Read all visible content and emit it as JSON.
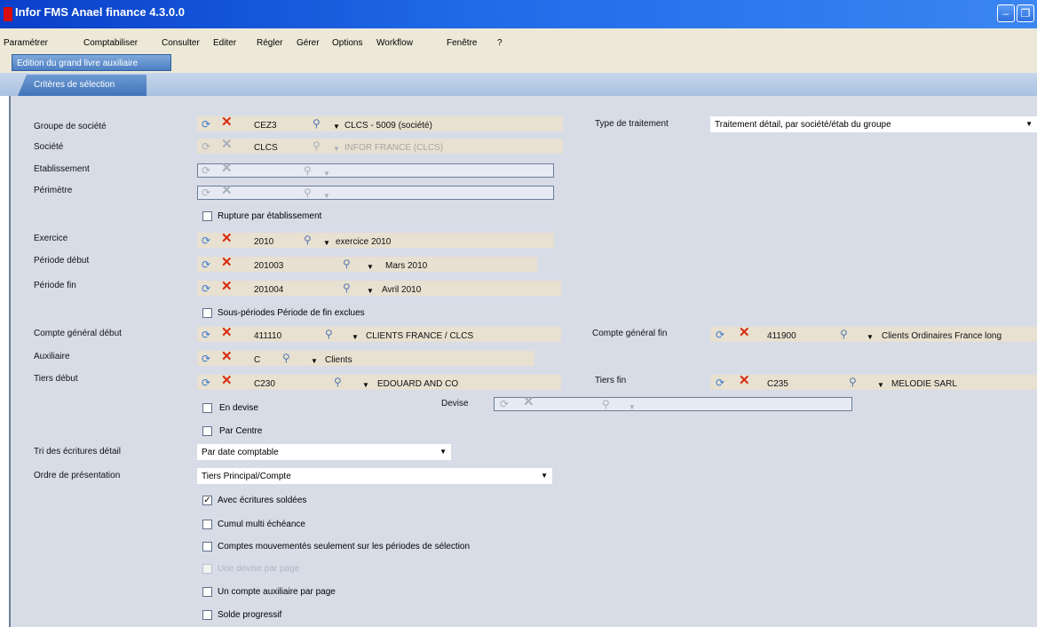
{
  "window": {
    "title": "Infor FMS Anael finance 4.3.0.0"
  },
  "menu": [
    "Paramétrer",
    "Comptabiliser",
    "Consulter",
    "Editer",
    "Régler",
    "Gérer",
    "Options",
    "Workflow",
    "Fenêtre",
    "?"
  ],
  "tabs": {
    "top": "Edition du grand livre auxiliaire",
    "sub": "Critères de sélection"
  },
  "fields": {
    "groupe": {
      "label": "Groupe de société",
      "code": "CEZ3",
      "desc": "CLCS - 5009 (société)"
    },
    "societe": {
      "label": "Société",
      "code": "CLCS",
      "desc": "INFOR FRANCE (CLCS)"
    },
    "etablissement": {
      "label": "Etablissement"
    },
    "perimetre": {
      "label": "Périmètre"
    },
    "rupture": {
      "label": "Rupture par établissement",
      "checked": false
    },
    "exercice": {
      "label": "Exercice",
      "code": "2010",
      "desc": "exercice 2010"
    },
    "periode_debut": {
      "label": "Période début",
      "code": "201003",
      "desc": "Mars 2010"
    },
    "periode_fin": {
      "label": "Période fin",
      "code": "201004",
      "desc": "Avril 2010"
    },
    "sous_periodes": {
      "label": "Sous-périodes Période de fin exclues",
      "checked": false
    },
    "compte_debut": {
      "label": "Compte général début",
      "code": "411110",
      "desc": "CLIENTS FRANCE / CLCS"
    },
    "auxiliaire": {
      "label": "Auxiliaire",
      "code": "C",
      "desc": "Clients"
    },
    "tiers_debut": {
      "label": "Tiers début",
      "code": "C230",
      "desc": "EDOUARD AND CO"
    },
    "type_traitement": {
      "label": "Type de traitement",
      "value": "Traitement détail, par société/étab du groupe"
    },
    "compte_fin": {
      "label": "Compte général fin",
      "code": "411900",
      "desc": "Clients Ordinaires France  long"
    },
    "tiers_fin": {
      "label": "Tiers fin",
      "code": "C235",
      "desc": "MELODIE SARL"
    },
    "en_devise": {
      "label": "En devise",
      "checked": false
    },
    "devise": {
      "label": "Devise"
    },
    "par_centre": {
      "label": "Par Centre",
      "checked": false
    },
    "tri": {
      "label": "Tri des écritures détail",
      "value": "Par date comptable"
    },
    "ordre": {
      "label": "Ordre de présentation",
      "value": "Tiers Principal/Compte"
    },
    "avec_soldees": {
      "label": "Avec écritures soldées",
      "checked": true
    },
    "cumul": {
      "label": "Cumul multi échéance",
      "checked": false
    },
    "comptes_mouv": {
      "label": "Comptes mouvementés seulement sur les périodes de sélection",
      "checked": false
    },
    "une_devise": {
      "label": "Une devise par page",
      "checked": false
    },
    "un_compte": {
      "label": "Un compte auxiliaire par page",
      "checked": false
    },
    "solde": {
      "label": "Solde progressif",
      "checked": false
    }
  },
  "icons": {
    "refresh": "refresh-icon",
    "clear": "clear-icon",
    "search": "search-icon",
    "dropdown": "dropdown-icon"
  }
}
